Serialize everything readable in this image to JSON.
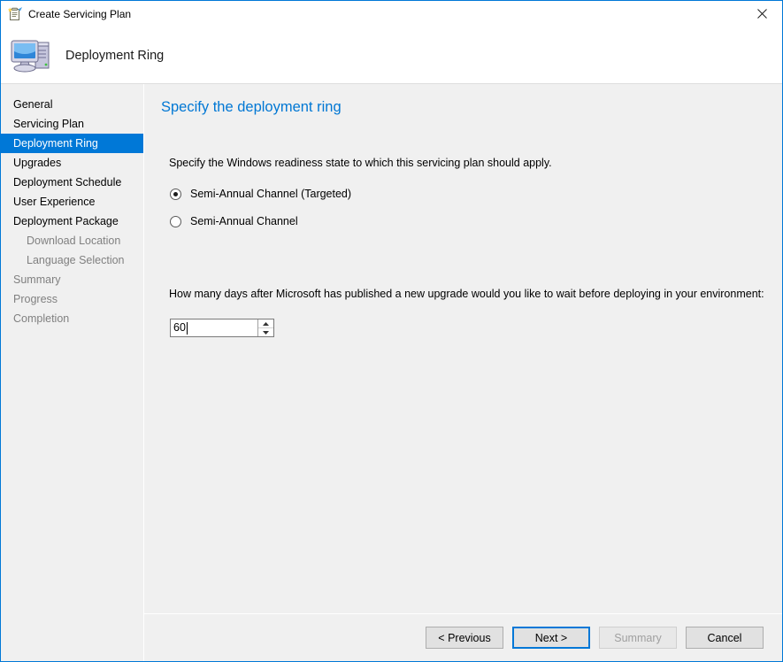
{
  "window": {
    "title": "Create Servicing Plan",
    "title_icon": "new-servicing-plan-icon",
    "close_icon": "close-icon",
    "header_title": "Deployment Ring",
    "header_icon": "computer-icon",
    "accent_color": "#0078d7",
    "panel_color": "#f0f0f0"
  },
  "sidebar": {
    "items": [
      {
        "label": "General",
        "state": "normal"
      },
      {
        "label": "Servicing Plan",
        "state": "normal"
      },
      {
        "label": "Deployment Ring",
        "state": "active"
      },
      {
        "label": "Upgrades",
        "state": "normal"
      },
      {
        "label": "Deployment Schedule",
        "state": "normal"
      },
      {
        "label": "User Experience",
        "state": "normal"
      },
      {
        "label": "Deployment Package",
        "state": "normal"
      },
      {
        "label": "Download Location",
        "state": "sub"
      },
      {
        "label": "Language Selection",
        "state": "sub"
      },
      {
        "label": "Summary",
        "state": "muted"
      },
      {
        "label": "Progress",
        "state": "muted"
      },
      {
        "label": "Completion",
        "state": "muted"
      }
    ]
  },
  "content": {
    "heading": "Specify the deployment ring",
    "heading_color": "#0077d4",
    "intro_text": "Specify the Windows readiness state to which this servicing plan should apply.",
    "radio_options": [
      {
        "label": "Semi-Annual Channel (Targeted)",
        "checked": true
      },
      {
        "label": "Semi-Annual Channel",
        "checked": false
      }
    ],
    "days_question": "How many days after Microsoft has published a new upgrade would you like to wait before deploying in your environment:",
    "days_value": "60"
  },
  "footer": {
    "buttons": [
      {
        "label": "< Previous",
        "state": "normal"
      },
      {
        "label": "Next >",
        "state": "default"
      },
      {
        "label": "Summary",
        "state": "disabled"
      },
      {
        "label": "Cancel",
        "state": "normal"
      }
    ]
  }
}
